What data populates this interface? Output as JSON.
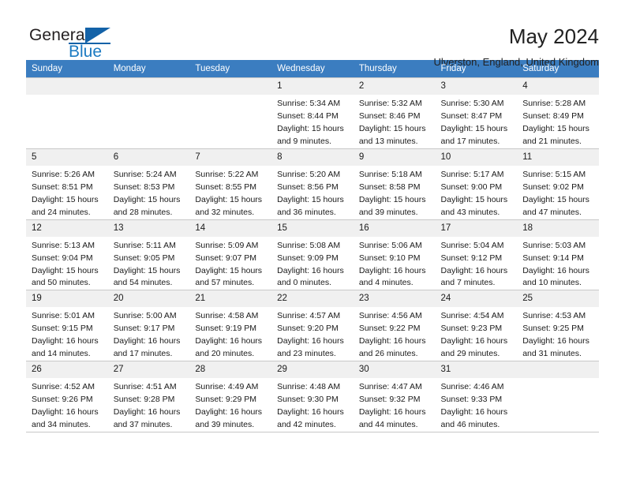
{
  "brand": {
    "name_part1": "General",
    "name_part2": "Blue",
    "logo_icon": "triangle-logo-icon"
  },
  "header": {
    "title": "May 2024",
    "subtitle": "Ulverston, England, United Kingdom"
  },
  "colors": {
    "header_blue": "#3b7dc0",
    "brand_blue": "#1362a8",
    "daynum_bg": "#f0f0f0",
    "grid_line": "#c8c8c8"
  },
  "weekday_headers": [
    "Sunday",
    "Monday",
    "Tuesday",
    "Wednesday",
    "Thursday",
    "Friday",
    "Saturday"
  ],
  "weeks": [
    [
      {
        "day": "",
        "sunrise": "",
        "sunset": "",
        "daylight": ""
      },
      {
        "day": "",
        "sunrise": "",
        "sunset": "",
        "daylight": ""
      },
      {
        "day": "",
        "sunrise": "",
        "sunset": "",
        "daylight": ""
      },
      {
        "day": "1",
        "sunrise": "Sunrise: 5:34 AM",
        "sunset": "Sunset: 8:44 PM",
        "daylight": "Daylight: 15 hours and 9 minutes."
      },
      {
        "day": "2",
        "sunrise": "Sunrise: 5:32 AM",
        "sunset": "Sunset: 8:46 PM",
        "daylight": "Daylight: 15 hours and 13 minutes."
      },
      {
        "day": "3",
        "sunrise": "Sunrise: 5:30 AM",
        "sunset": "Sunset: 8:47 PM",
        "daylight": "Daylight: 15 hours and 17 minutes."
      },
      {
        "day": "4",
        "sunrise": "Sunrise: 5:28 AM",
        "sunset": "Sunset: 8:49 PM",
        "daylight": "Daylight: 15 hours and 21 minutes."
      }
    ],
    [
      {
        "day": "5",
        "sunrise": "Sunrise: 5:26 AM",
        "sunset": "Sunset: 8:51 PM",
        "daylight": "Daylight: 15 hours and 24 minutes."
      },
      {
        "day": "6",
        "sunrise": "Sunrise: 5:24 AM",
        "sunset": "Sunset: 8:53 PM",
        "daylight": "Daylight: 15 hours and 28 minutes."
      },
      {
        "day": "7",
        "sunrise": "Sunrise: 5:22 AM",
        "sunset": "Sunset: 8:55 PM",
        "daylight": "Daylight: 15 hours and 32 minutes."
      },
      {
        "day": "8",
        "sunrise": "Sunrise: 5:20 AM",
        "sunset": "Sunset: 8:56 PM",
        "daylight": "Daylight: 15 hours and 36 minutes."
      },
      {
        "day": "9",
        "sunrise": "Sunrise: 5:18 AM",
        "sunset": "Sunset: 8:58 PM",
        "daylight": "Daylight: 15 hours and 39 minutes."
      },
      {
        "day": "10",
        "sunrise": "Sunrise: 5:17 AM",
        "sunset": "Sunset: 9:00 PM",
        "daylight": "Daylight: 15 hours and 43 minutes."
      },
      {
        "day": "11",
        "sunrise": "Sunrise: 5:15 AM",
        "sunset": "Sunset: 9:02 PM",
        "daylight": "Daylight: 15 hours and 47 minutes."
      }
    ],
    [
      {
        "day": "12",
        "sunrise": "Sunrise: 5:13 AM",
        "sunset": "Sunset: 9:04 PM",
        "daylight": "Daylight: 15 hours and 50 minutes."
      },
      {
        "day": "13",
        "sunrise": "Sunrise: 5:11 AM",
        "sunset": "Sunset: 9:05 PM",
        "daylight": "Daylight: 15 hours and 54 minutes."
      },
      {
        "day": "14",
        "sunrise": "Sunrise: 5:09 AM",
        "sunset": "Sunset: 9:07 PM",
        "daylight": "Daylight: 15 hours and 57 minutes."
      },
      {
        "day": "15",
        "sunrise": "Sunrise: 5:08 AM",
        "sunset": "Sunset: 9:09 PM",
        "daylight": "Daylight: 16 hours and 0 minutes."
      },
      {
        "day": "16",
        "sunrise": "Sunrise: 5:06 AM",
        "sunset": "Sunset: 9:10 PM",
        "daylight": "Daylight: 16 hours and 4 minutes."
      },
      {
        "day": "17",
        "sunrise": "Sunrise: 5:04 AM",
        "sunset": "Sunset: 9:12 PM",
        "daylight": "Daylight: 16 hours and 7 minutes."
      },
      {
        "day": "18",
        "sunrise": "Sunrise: 5:03 AM",
        "sunset": "Sunset: 9:14 PM",
        "daylight": "Daylight: 16 hours and 10 minutes."
      }
    ],
    [
      {
        "day": "19",
        "sunrise": "Sunrise: 5:01 AM",
        "sunset": "Sunset: 9:15 PM",
        "daylight": "Daylight: 16 hours and 14 minutes."
      },
      {
        "day": "20",
        "sunrise": "Sunrise: 5:00 AM",
        "sunset": "Sunset: 9:17 PM",
        "daylight": "Daylight: 16 hours and 17 minutes."
      },
      {
        "day": "21",
        "sunrise": "Sunrise: 4:58 AM",
        "sunset": "Sunset: 9:19 PM",
        "daylight": "Daylight: 16 hours and 20 minutes."
      },
      {
        "day": "22",
        "sunrise": "Sunrise: 4:57 AM",
        "sunset": "Sunset: 9:20 PM",
        "daylight": "Daylight: 16 hours and 23 minutes."
      },
      {
        "day": "23",
        "sunrise": "Sunrise: 4:56 AM",
        "sunset": "Sunset: 9:22 PM",
        "daylight": "Daylight: 16 hours and 26 minutes."
      },
      {
        "day": "24",
        "sunrise": "Sunrise: 4:54 AM",
        "sunset": "Sunset: 9:23 PM",
        "daylight": "Daylight: 16 hours and 29 minutes."
      },
      {
        "day": "25",
        "sunrise": "Sunrise: 4:53 AM",
        "sunset": "Sunset: 9:25 PM",
        "daylight": "Daylight: 16 hours and 31 minutes."
      }
    ],
    [
      {
        "day": "26",
        "sunrise": "Sunrise: 4:52 AM",
        "sunset": "Sunset: 9:26 PM",
        "daylight": "Daylight: 16 hours and 34 minutes."
      },
      {
        "day": "27",
        "sunrise": "Sunrise: 4:51 AM",
        "sunset": "Sunset: 9:28 PM",
        "daylight": "Daylight: 16 hours and 37 minutes."
      },
      {
        "day": "28",
        "sunrise": "Sunrise: 4:49 AM",
        "sunset": "Sunset: 9:29 PM",
        "daylight": "Daylight: 16 hours and 39 minutes."
      },
      {
        "day": "29",
        "sunrise": "Sunrise: 4:48 AM",
        "sunset": "Sunset: 9:30 PM",
        "daylight": "Daylight: 16 hours and 42 minutes."
      },
      {
        "day": "30",
        "sunrise": "Sunrise: 4:47 AM",
        "sunset": "Sunset: 9:32 PM",
        "daylight": "Daylight: 16 hours and 44 minutes."
      },
      {
        "day": "31",
        "sunrise": "Sunrise: 4:46 AM",
        "sunset": "Sunset: 9:33 PM",
        "daylight": "Daylight: 16 hours and 46 minutes."
      },
      {
        "day": "",
        "sunrise": "",
        "sunset": "",
        "daylight": ""
      }
    ]
  ]
}
